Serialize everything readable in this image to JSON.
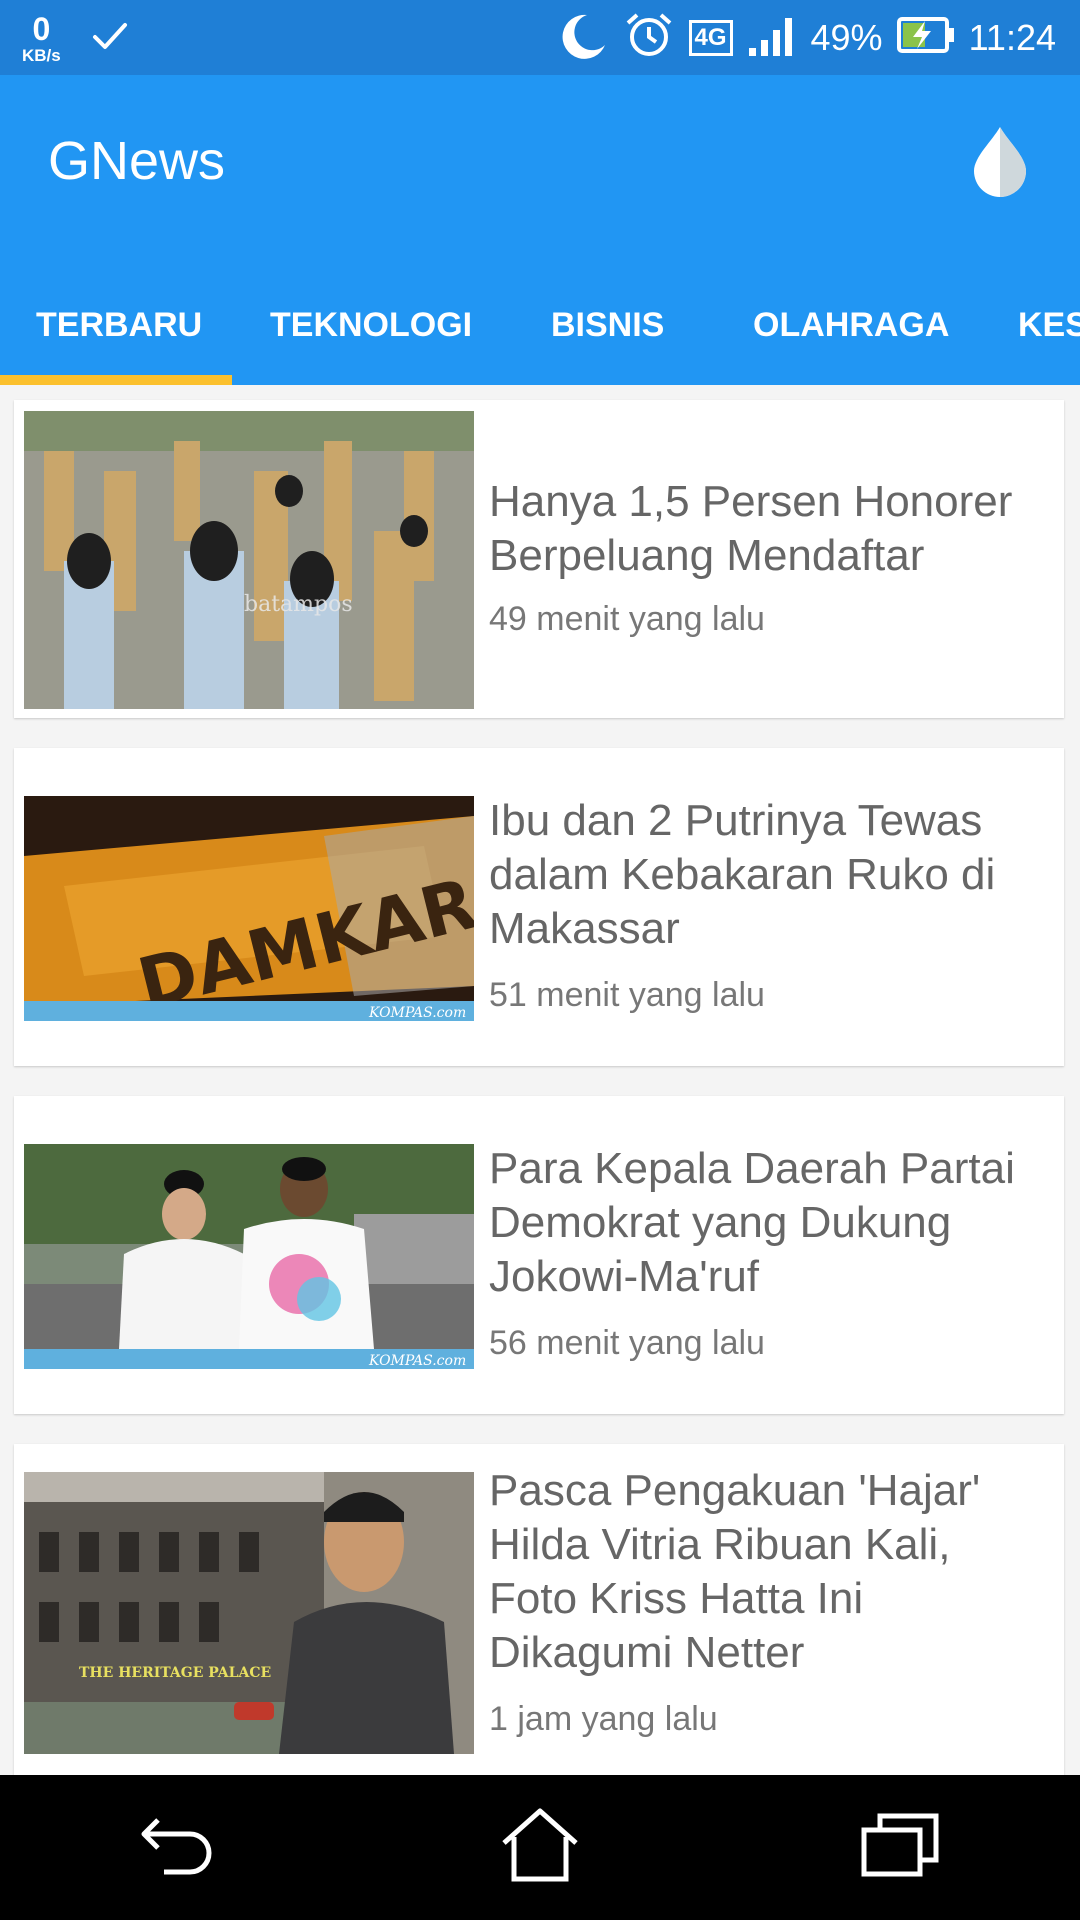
{
  "status_bar": {
    "net_speed_value": "0",
    "net_speed_unit": "KB/s",
    "network_type": "4G",
    "battery": "49%",
    "time": "11:24",
    "icons": [
      "check-icon",
      "moon-icon",
      "alarm-icon",
      "signal-icon",
      "battery-charging-icon"
    ]
  },
  "app_bar": {
    "title": "GNews",
    "theme_icon": "water-drop-icon",
    "background": "#2196f3",
    "accent": "#fbc02d"
  },
  "tabs": [
    {
      "label": "TERBARU",
      "selected": true
    },
    {
      "label": "TEKNOLOGI",
      "selected": false
    },
    {
      "label": "BISNIS",
      "selected": false
    },
    {
      "label": "OLAHRAGA",
      "selected": false
    },
    {
      "label": "KES",
      "selected": false
    }
  ],
  "articles": [
    {
      "title": "Hanya 1,5 Persen Honorer Berpeluang Mendaftar",
      "time": "49 menit yang lalu",
      "image_watermark": "batampos"
    },
    {
      "title": "Ibu dan 2 Putrinya Tewas dalam Kebakaran Ruko di Makassar",
      "time": "51 menit yang lalu",
      "image_text": "DAMKAR",
      "image_watermark": "KOMPAS.com"
    },
    {
      "title": "Para Kepala Daerah Partai Demokrat yang Dukung Jokowi-Ma'ruf",
      "time": "56 menit yang lalu",
      "image_watermark": "KOMPAS.com"
    },
    {
      "title": "Pasca Pengakuan 'Hajar' Hilda Vitria Ribuan Kali, Foto Kriss Hatta Ini Dikagumi Netter",
      "time": "1 jam yang lalu",
      "image_text": "THE HERITAGE PALACE"
    }
  ],
  "nav_bar": {
    "icons": [
      "back-icon",
      "home-icon",
      "recents-icon"
    ]
  }
}
